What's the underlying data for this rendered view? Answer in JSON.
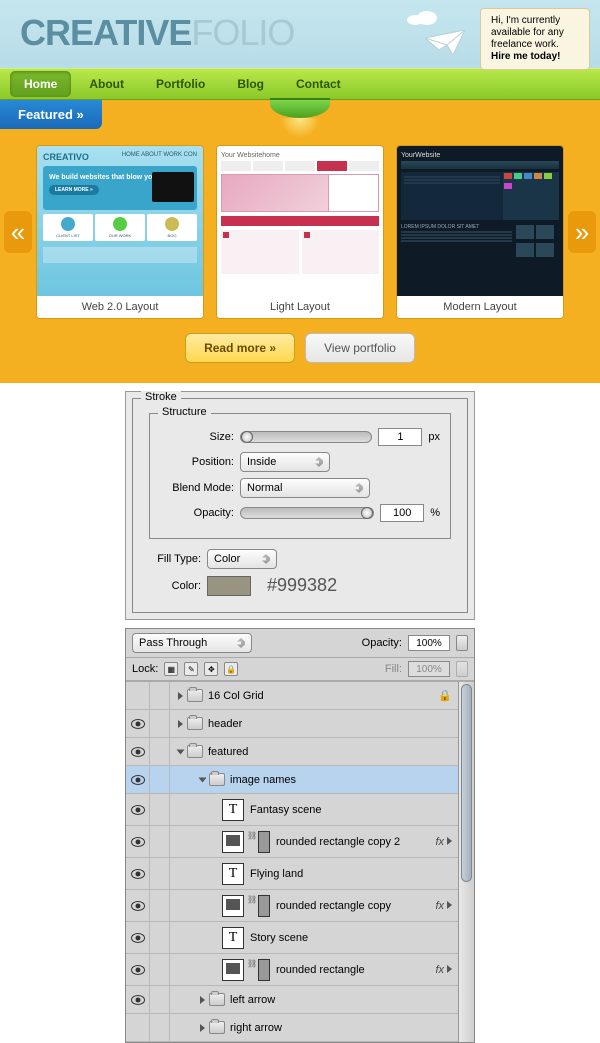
{
  "header": {
    "logo_dark": "CREATIVE",
    "logo_light": "FOLIO",
    "note_line1": "Hi, I'm currently",
    "note_line2": "available for any",
    "note_line3": "freelance work.",
    "note_cta": "Hire me today!"
  },
  "nav": {
    "items": [
      "Home",
      "About",
      "Portfolio",
      "Blog",
      "Contact"
    ],
    "active_index": 0
  },
  "featured": {
    "tab": "Featured »",
    "arrows": {
      "left": "«",
      "right": "»"
    },
    "thumbs": [
      {
        "caption": "Web 2.0 Layout"
      },
      {
        "caption": "Light Layout"
      },
      {
        "caption": "Modern Layout"
      }
    ],
    "mock_blue": {
      "logo": "CREATIVO",
      "menu": "HOME  ABOUT  WORK  CON",
      "hero": "We build websites that blow you away.",
      "cta": "LEARN MORE »",
      "cards": [
        "CLIENT LIST",
        "OUR WORK",
        "BOO"
      ]
    },
    "mock_light": {
      "logo": "Your Websitehome"
    },
    "mock_dark": {
      "logo": "YourWebsite",
      "lorem": "LOREM IPSUM DOLOR SIT AMET"
    },
    "read_more": "Read more »",
    "view_portfolio": "View portfolio"
  },
  "stroke_panel": {
    "title": "Stroke",
    "structure_title": "Structure",
    "size_label": "Size:",
    "size_value": "1",
    "size_unit": "px",
    "position_label": "Position:",
    "position_value": "Inside",
    "blend_label": "Blend Mode:",
    "blend_value": "Normal",
    "opacity_label": "Opacity:",
    "opacity_value": "100",
    "opacity_unit": "%",
    "fill_type_label": "Fill Type:",
    "fill_type_value": "Color",
    "color_label": "Color:",
    "color_hex": "#999382",
    "swatch_color": "#999382"
  },
  "layers_panel": {
    "blend_mode": "Pass Through",
    "opacity_label": "Opacity:",
    "opacity_value": "100%",
    "lock_label": "Lock:",
    "fill_label": "Fill:",
    "fill_value": "100%",
    "layers": [
      {
        "name": "16 Col Grid",
        "type": "folder",
        "open": false,
        "indent": 0,
        "locked": true,
        "eye": false
      },
      {
        "name": "header",
        "type": "folder",
        "open": false,
        "indent": 0,
        "eye": true
      },
      {
        "name": "featured",
        "type": "folder",
        "open": true,
        "indent": 0,
        "eye": true
      },
      {
        "name": "image names",
        "type": "folder",
        "open": true,
        "indent": 1,
        "eye": true,
        "selected": true
      },
      {
        "name": "Fantasy scene",
        "type": "text",
        "indent": 2,
        "eye": true
      },
      {
        "name": "rounded rectangle copy 2",
        "type": "shape",
        "indent": 2,
        "eye": true,
        "fx": true
      },
      {
        "name": "Flying land",
        "type": "text",
        "indent": 2,
        "eye": true
      },
      {
        "name": "rounded rectangle copy",
        "type": "shape",
        "indent": 2,
        "eye": true,
        "fx": true
      },
      {
        "name": "Story scene",
        "type": "text",
        "indent": 2,
        "eye": true
      },
      {
        "name": "rounded rectangle",
        "type": "shape",
        "indent": 2,
        "eye": true,
        "fx": true
      },
      {
        "name": "left arrow",
        "type": "folder",
        "open": false,
        "indent": 1,
        "eye": true
      },
      {
        "name": "right arrow",
        "type": "folder",
        "open": false,
        "indent": 1,
        "eye": false
      }
    ]
  }
}
